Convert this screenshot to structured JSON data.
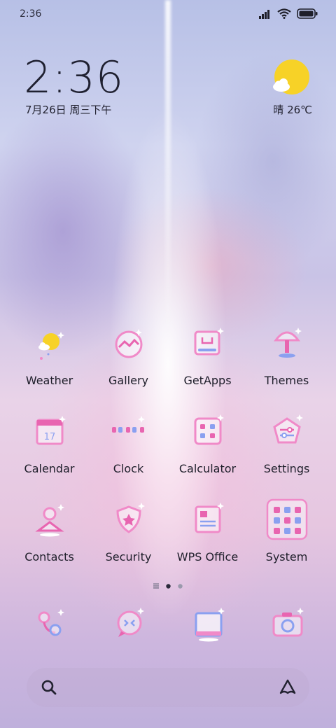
{
  "status_bar": {
    "time": "2:36",
    "signal_icon": "signal-icon",
    "wifi_icon": "wifi-icon",
    "battery_icon": "battery-icon"
  },
  "widget": {
    "clock": "2:36",
    "date": "7月26日 周三下午",
    "weather_icon": "sun-cloud-icon",
    "weather_text": "晴 26℃"
  },
  "apps": [
    {
      "label": "Weather",
      "icon": "weather-icon"
    },
    {
      "label": "Gallery",
      "icon": "gallery-icon"
    },
    {
      "label": "GetApps",
      "icon": "getapps-icon"
    },
    {
      "label": "Themes",
      "icon": "themes-icon"
    },
    {
      "label": "Calendar",
      "icon": "calendar-icon"
    },
    {
      "label": "Clock",
      "icon": "clock-icon"
    },
    {
      "label": "Calculator",
      "icon": "calculator-icon"
    },
    {
      "label": "Settings",
      "icon": "settings-icon"
    },
    {
      "label": "Contacts",
      "icon": "contacts-icon"
    },
    {
      "label": "Security",
      "icon": "security-icon"
    },
    {
      "label": "WPS Office",
      "icon": "wps-office-icon"
    },
    {
      "label": "System",
      "icon": "system-folder-icon"
    }
  ],
  "page_indicator": {
    "pages": 3,
    "current": 2
  },
  "dock": [
    {
      "icon": "phone-icon"
    },
    {
      "icon": "messages-icon"
    },
    {
      "icon": "browser-icon"
    },
    {
      "icon": "camera-icon"
    }
  ],
  "search_bar": {
    "search_icon": "search-icon",
    "assistant_icon": "assistant-icon"
  },
  "colors": {
    "icon_pink": "#f08ac8",
    "icon_blue": "#8aa0f0",
    "sun_yellow": "#f7d227",
    "text_dark": "#1e1e2a"
  }
}
